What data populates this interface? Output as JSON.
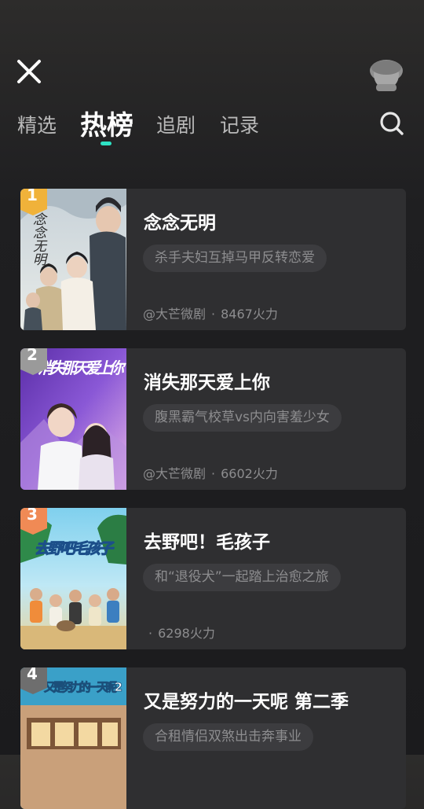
{
  "header": {
    "close_icon": "close-icon",
    "avatar_icon": "user-avatar-icon",
    "search_icon": "search-icon"
  },
  "tabs": [
    {
      "label": "精选",
      "active": false
    },
    {
      "label": "热榜",
      "active": true
    },
    {
      "label": "追剧",
      "active": false
    },
    {
      "label": "记录",
      "active": false
    }
  ],
  "colors": {
    "accent": "#2ee2c4",
    "rank1": "#f0b23a",
    "rank2": "#9a9a9a",
    "rank3": "#f08a55",
    "rank4": "#6e6e6e"
  },
  "ranking": [
    {
      "rank": "1",
      "title": "念念无明",
      "tag": "杀手夫妇互掉马甲反转恋爱",
      "author": "@大芒微剧",
      "dot": "·",
      "heat": "8467火力",
      "poster_text": "念念无明"
    },
    {
      "rank": "2",
      "title": "消失那天爱上你",
      "tag": "腹黑霸气校草vs内向害羞少女",
      "author": "@大芒微剧",
      "dot": "·",
      "heat": "6602火力",
      "poster_text": "消失那天爱上你"
    },
    {
      "rank": "3",
      "title": "去野吧！毛孩子",
      "tag": "和“退役犬”一起踏上治愈之旅",
      "author": "",
      "dot": "·",
      "heat": "6298火力",
      "poster_text": "去野吧毛孩子"
    },
    {
      "rank": "4",
      "title": "又是努力的一天呢 第二季",
      "tag": "合租情侣双煞出击奔事业",
      "author": "",
      "dot": "",
      "heat": "",
      "poster_text": "又是努力的一天呢2"
    }
  ]
}
